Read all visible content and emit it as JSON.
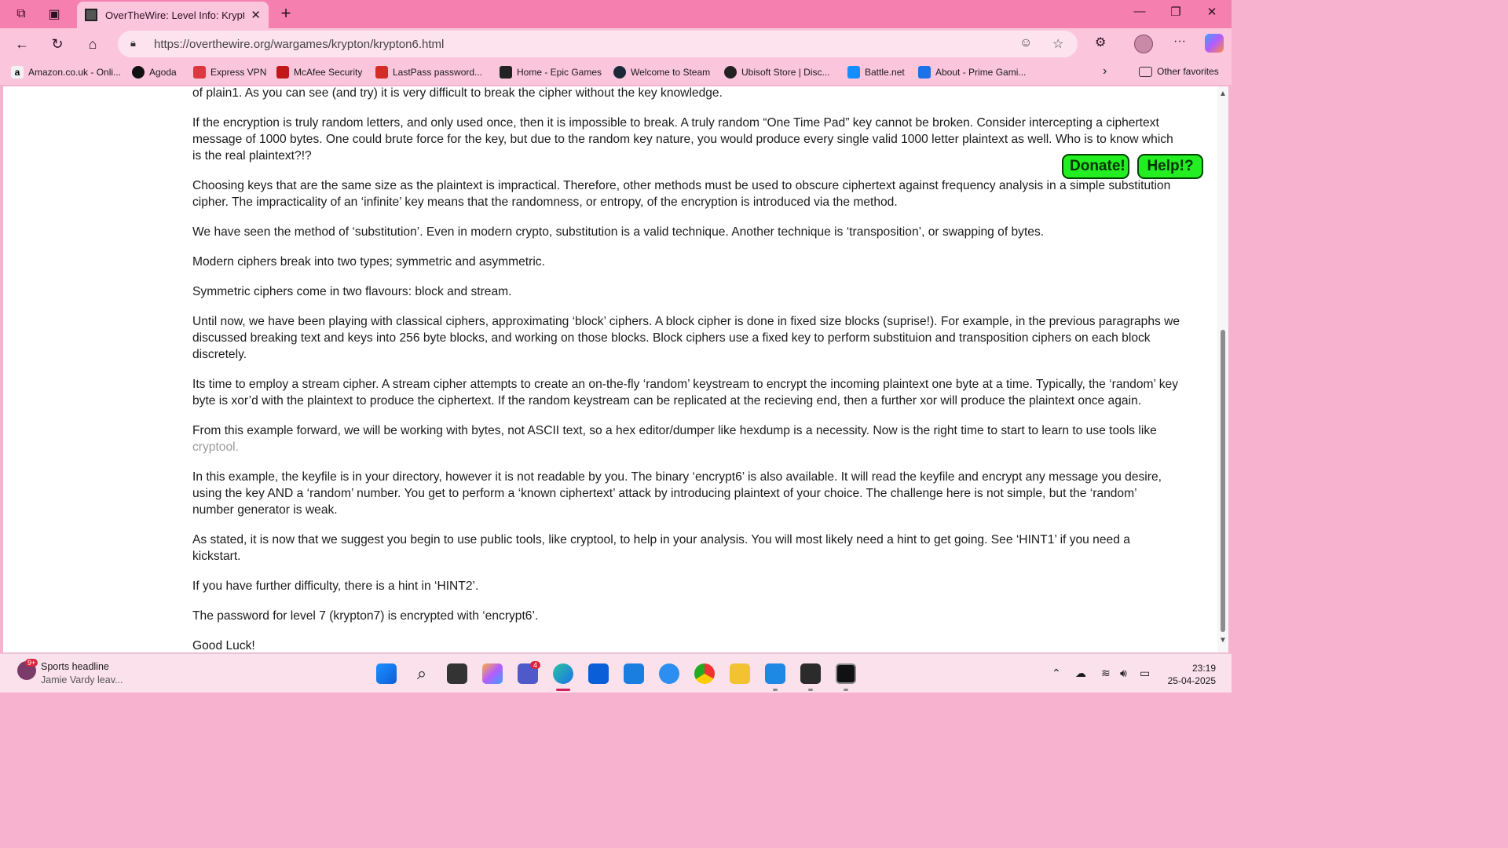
{
  "browser": {
    "tab_title": "OverTheWire: Level Info: Krypton",
    "url": "https://overthewire.org/wargames/krypton/krypton6.html"
  },
  "bookmarks": [
    {
      "label": "Amazon.co.uk - Onli...",
      "icon": "amazon-icon"
    },
    {
      "label": "Agoda",
      "icon": "hp-icon"
    },
    {
      "label": "Express VPN",
      "icon": "expressvpn-icon"
    },
    {
      "label": "McAfee Security",
      "icon": "mcafee-icon"
    },
    {
      "label": "LastPass password...",
      "icon": "lastpass-icon"
    },
    {
      "label": "Home - Epic Games",
      "icon": "epic-games-icon"
    },
    {
      "label": "Welcome to Steam",
      "icon": "steam-icon"
    },
    {
      "label": "Ubisoft Store | Disc...",
      "icon": "ubisoft-icon"
    },
    {
      "label": "Battle.net",
      "icon": "battlenet-icon"
    },
    {
      "label": "About - Prime Gami...",
      "icon": "prime-gaming-icon"
    }
  ],
  "other_favorites": "Other favorites",
  "content": {
    "paragraphs": [
      "of plain1. As you can see (and try) it is very difficult to break the cipher without the key knowledge.",
      "If the encryption is truly random letters, and only used once, then it is impossible to break. A truly random “One Time Pad” key cannot be broken. Consider intercepting a ciphertext message of 1000 bytes. One could brute force for the key, but due to the random key nature, you would produce every single valid 1000 letter plaintext as well. Who is to know which is the real plaintext?!?",
      "Choosing keys that are the same size as the plaintext is impractical. Therefore, other methods must be used to obscure ciphertext against frequency analysis in a simple substitution cipher. The impracticality of an ‘infinite’ key means that the randomness, or entropy, of the encryption is introduced via the method.",
      "We have seen the method of ‘substitution’. Even in modern crypto, substitution is a valid technique. Another technique is ‘transposition’, or swapping of bytes.",
      "Modern ciphers break into two types; symmetric and asymmetric.",
      "Symmetric ciphers come in two flavours: block and stream.",
      "Until now, we have been playing with classical ciphers, approximating ‘block’ ciphers. A block cipher is done in fixed size blocks (suprise!). For example, in the previous paragraphs we discussed breaking text and keys into 256 byte blocks, and working on those blocks. Block ciphers use a fixed key to perform substituion and transposition ciphers on each block discretely.",
      "Its time to employ a stream cipher. A stream cipher attempts to create an on-the-fly ‘random’ keystream to encrypt the incoming plaintext one byte at a time. Typically, the ‘random’ key byte is xor’d with the plaintext to produce the ciphertext. If the random keystream can be replicated at the recieving end, then a further xor will produce the plaintext once again."
    ],
    "p9_text": "From this example forward, we will be working with bytes, not ASCII text, so a hex editor/dumper like hexdump is a necessity. Now is the right time to start to learn to use tools like",
    "p9_link": "cryptool.",
    "paragraphs_after": [
      "In this example, the keyfile is in your directory, however it is not readable by you. The binary ‘encrypt6’ is also available. It will read the keyfile and encrypt any message you desire, using the key AND a ‘random’ number. You get to perform a ‘known ciphertext’ attack by introducing plaintext of your choice. The challenge here is not simple, but the ‘random’ number generator is weak.",
      "As stated, it is now that we suggest you begin to use public tools, like cryptool, to help in your analysis. You will most likely need a hint to get going. See ‘HINT1’ if you need a kickstart.",
      "If you have further difficulty, there is a hint in ‘HINT2’.",
      "The password for level 7 (krypton7) is encrypted with ‘encrypt6’.",
      "Good Luck!"
    ],
    "donate_label": "Donate!",
    "help_label": "Help!?"
  },
  "taskbar": {
    "news_badge": "9+",
    "news_title": "Sports headline",
    "news_sub": "Jamie Vardy leav...",
    "teams_badge": "4",
    "time": "23:19",
    "date": "25-04-2025"
  },
  "colors": {
    "tabbar": "#f57fae",
    "toolbar": "#fbc6dc",
    "float_button": "#22ee22"
  }
}
